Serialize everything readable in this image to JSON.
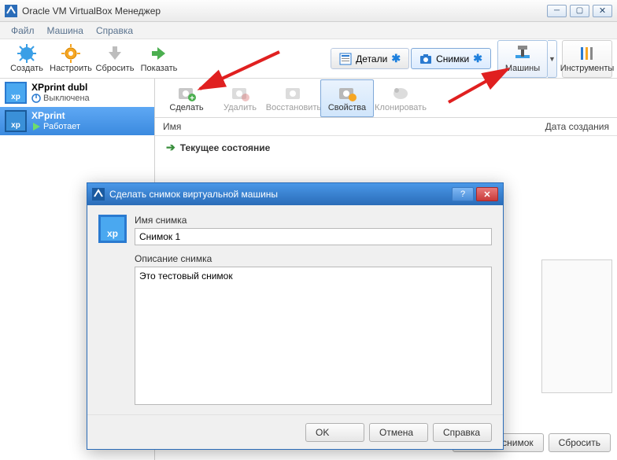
{
  "window": {
    "title": "Oracle VM VirtualBox Менеджер"
  },
  "menu": {
    "file": "Файл",
    "machine": "Машина",
    "help": "Справка"
  },
  "toolbar": {
    "create": "Создать",
    "settings": "Настроить",
    "discard": "Сбросить",
    "show": "Показать",
    "details": "Детали",
    "snapshots": "Снимки",
    "machines": "Машины",
    "tools": "Инструменты"
  },
  "vms": [
    {
      "name": "XPprint dubl",
      "state": "Выключена",
      "state_icon": "power-off"
    },
    {
      "name": "XPprint",
      "state": "Работает",
      "state_icon": "running"
    }
  ],
  "snap_toolbar": {
    "take": "Сделать",
    "delete": "Удалить",
    "restore": "Восстановить",
    "properties": "Свойства",
    "clone": "Клонировать"
  },
  "snap_columns": {
    "name": "Имя",
    "date": "Дата создания"
  },
  "tree": {
    "current": "Текущее состояние"
  },
  "bottom": {
    "take_snapshot": "Сделать снимок",
    "discard": "Сбросить"
  },
  "dialog": {
    "title": "Сделать снимок виртуальной машины",
    "name_label": "Имя снимка",
    "name_value": "Снимок 1",
    "desc_label": "Описание снимка",
    "desc_value": "Это тестовый снимок",
    "ok": "OK",
    "cancel": "Отмена",
    "help": "Справка"
  }
}
